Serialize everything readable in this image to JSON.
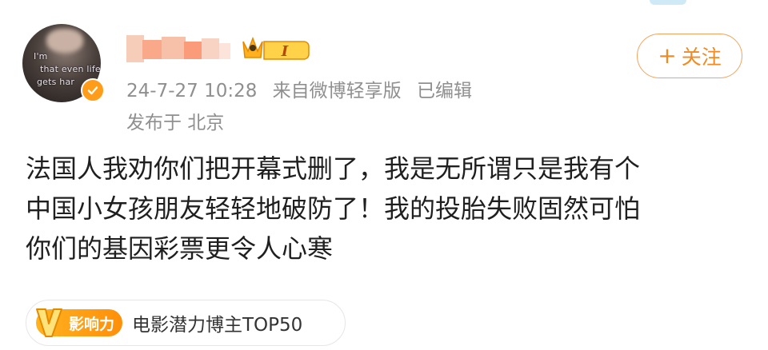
{
  "post": {
    "avatar_text": [
      "I'm",
      "that even life",
      "gets har"
    ],
    "timestamp": "24-7-27 10:28",
    "source": "来自微博轻享版",
    "edited": "已编辑",
    "location": "发布于 北京",
    "follow_label": "关注",
    "body_lines": [
      "法国人我劝你们把开幕式删了，我是无所谓只是我有个",
      "中国小女孩朋友轻轻地破防了！我的投胎失败固然可怕",
      "你们的基因彩票更令人心寒"
    ],
    "badge_pill": "影响力",
    "badge_label": "电影潜力博主TOP50",
    "crown_level": "I"
  },
  "colors": {
    "accent": "#f08a24",
    "verify": "#ff9d1a",
    "meta": "#8f8f8f"
  }
}
